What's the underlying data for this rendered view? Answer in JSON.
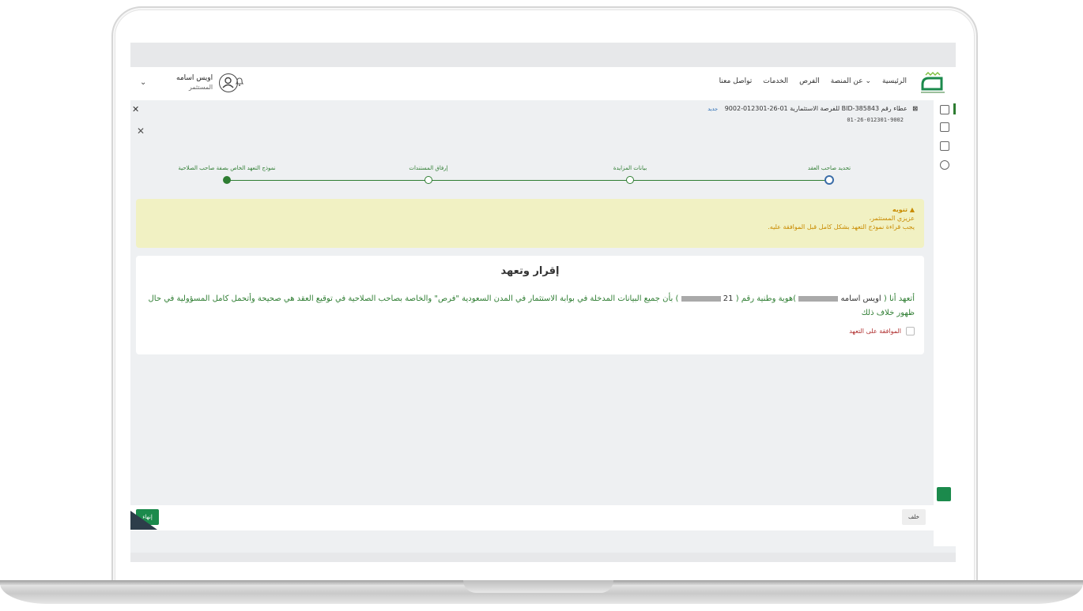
{
  "nav": {
    "items": [
      "الرئيسية",
      "عن المنصة ⌄",
      "الفرص",
      "الخدمات",
      "تواصل معنا"
    ]
  },
  "user": {
    "name": "اويس اسامه",
    "role": "المستثمر"
  },
  "bid": {
    "title": "عطاء رقم BID-385843 للفرصة الاستثمارية 01-26-012301-9002",
    "badge": "جديد",
    "code": "01-26-012301-9002"
  },
  "steps": [
    {
      "label": "تحديد صاحب العقد",
      "state": "current"
    },
    {
      "label": "بيانات المزايدة",
      "state": "pending"
    },
    {
      "label": "إرفاق المستندات",
      "state": "pending"
    },
    {
      "label": "نموذج التعهد الخاص بصفة صاحب الصلاحية",
      "state": "done"
    }
  ],
  "alert": {
    "title": "▲  تنويه",
    "line1": "عزيزي المستثمر،",
    "line2": "يجب قراءة نموذج التعهد بشكل كامل قبل الموافقة عليه."
  },
  "pledge": {
    "heading": "إقرار وتعهد",
    "part1": "أتعهد أنا (",
    "name": "اويس اسامه",
    "part2": ")هوية وطنية رقم (",
    "id_prefix": "21",
    "part3": ") بأن جميع البيانات المدخلة في بوابة الاستثمار في المدن السعودية \"فرص\" والخاصة بصاحب الصلاحية في توقيع العقد هي صحيحة وأتحمل كامل المسؤولية في حال ظهور خلاف ذلك",
    "agree_label": "الموافقة على التعهد"
  },
  "footer": {
    "end_button": "إنهاء",
    "back_button": "خلف"
  },
  "icons": {
    "bell": "bell-icon",
    "avatar": "user-avatar-icon",
    "close": "close-icon"
  },
  "colors": {
    "brand_green": "#1b8a4c",
    "step_green": "#2e7d32",
    "alert_bg": "#f1f1c3",
    "alert_text": "#c98b00"
  }
}
